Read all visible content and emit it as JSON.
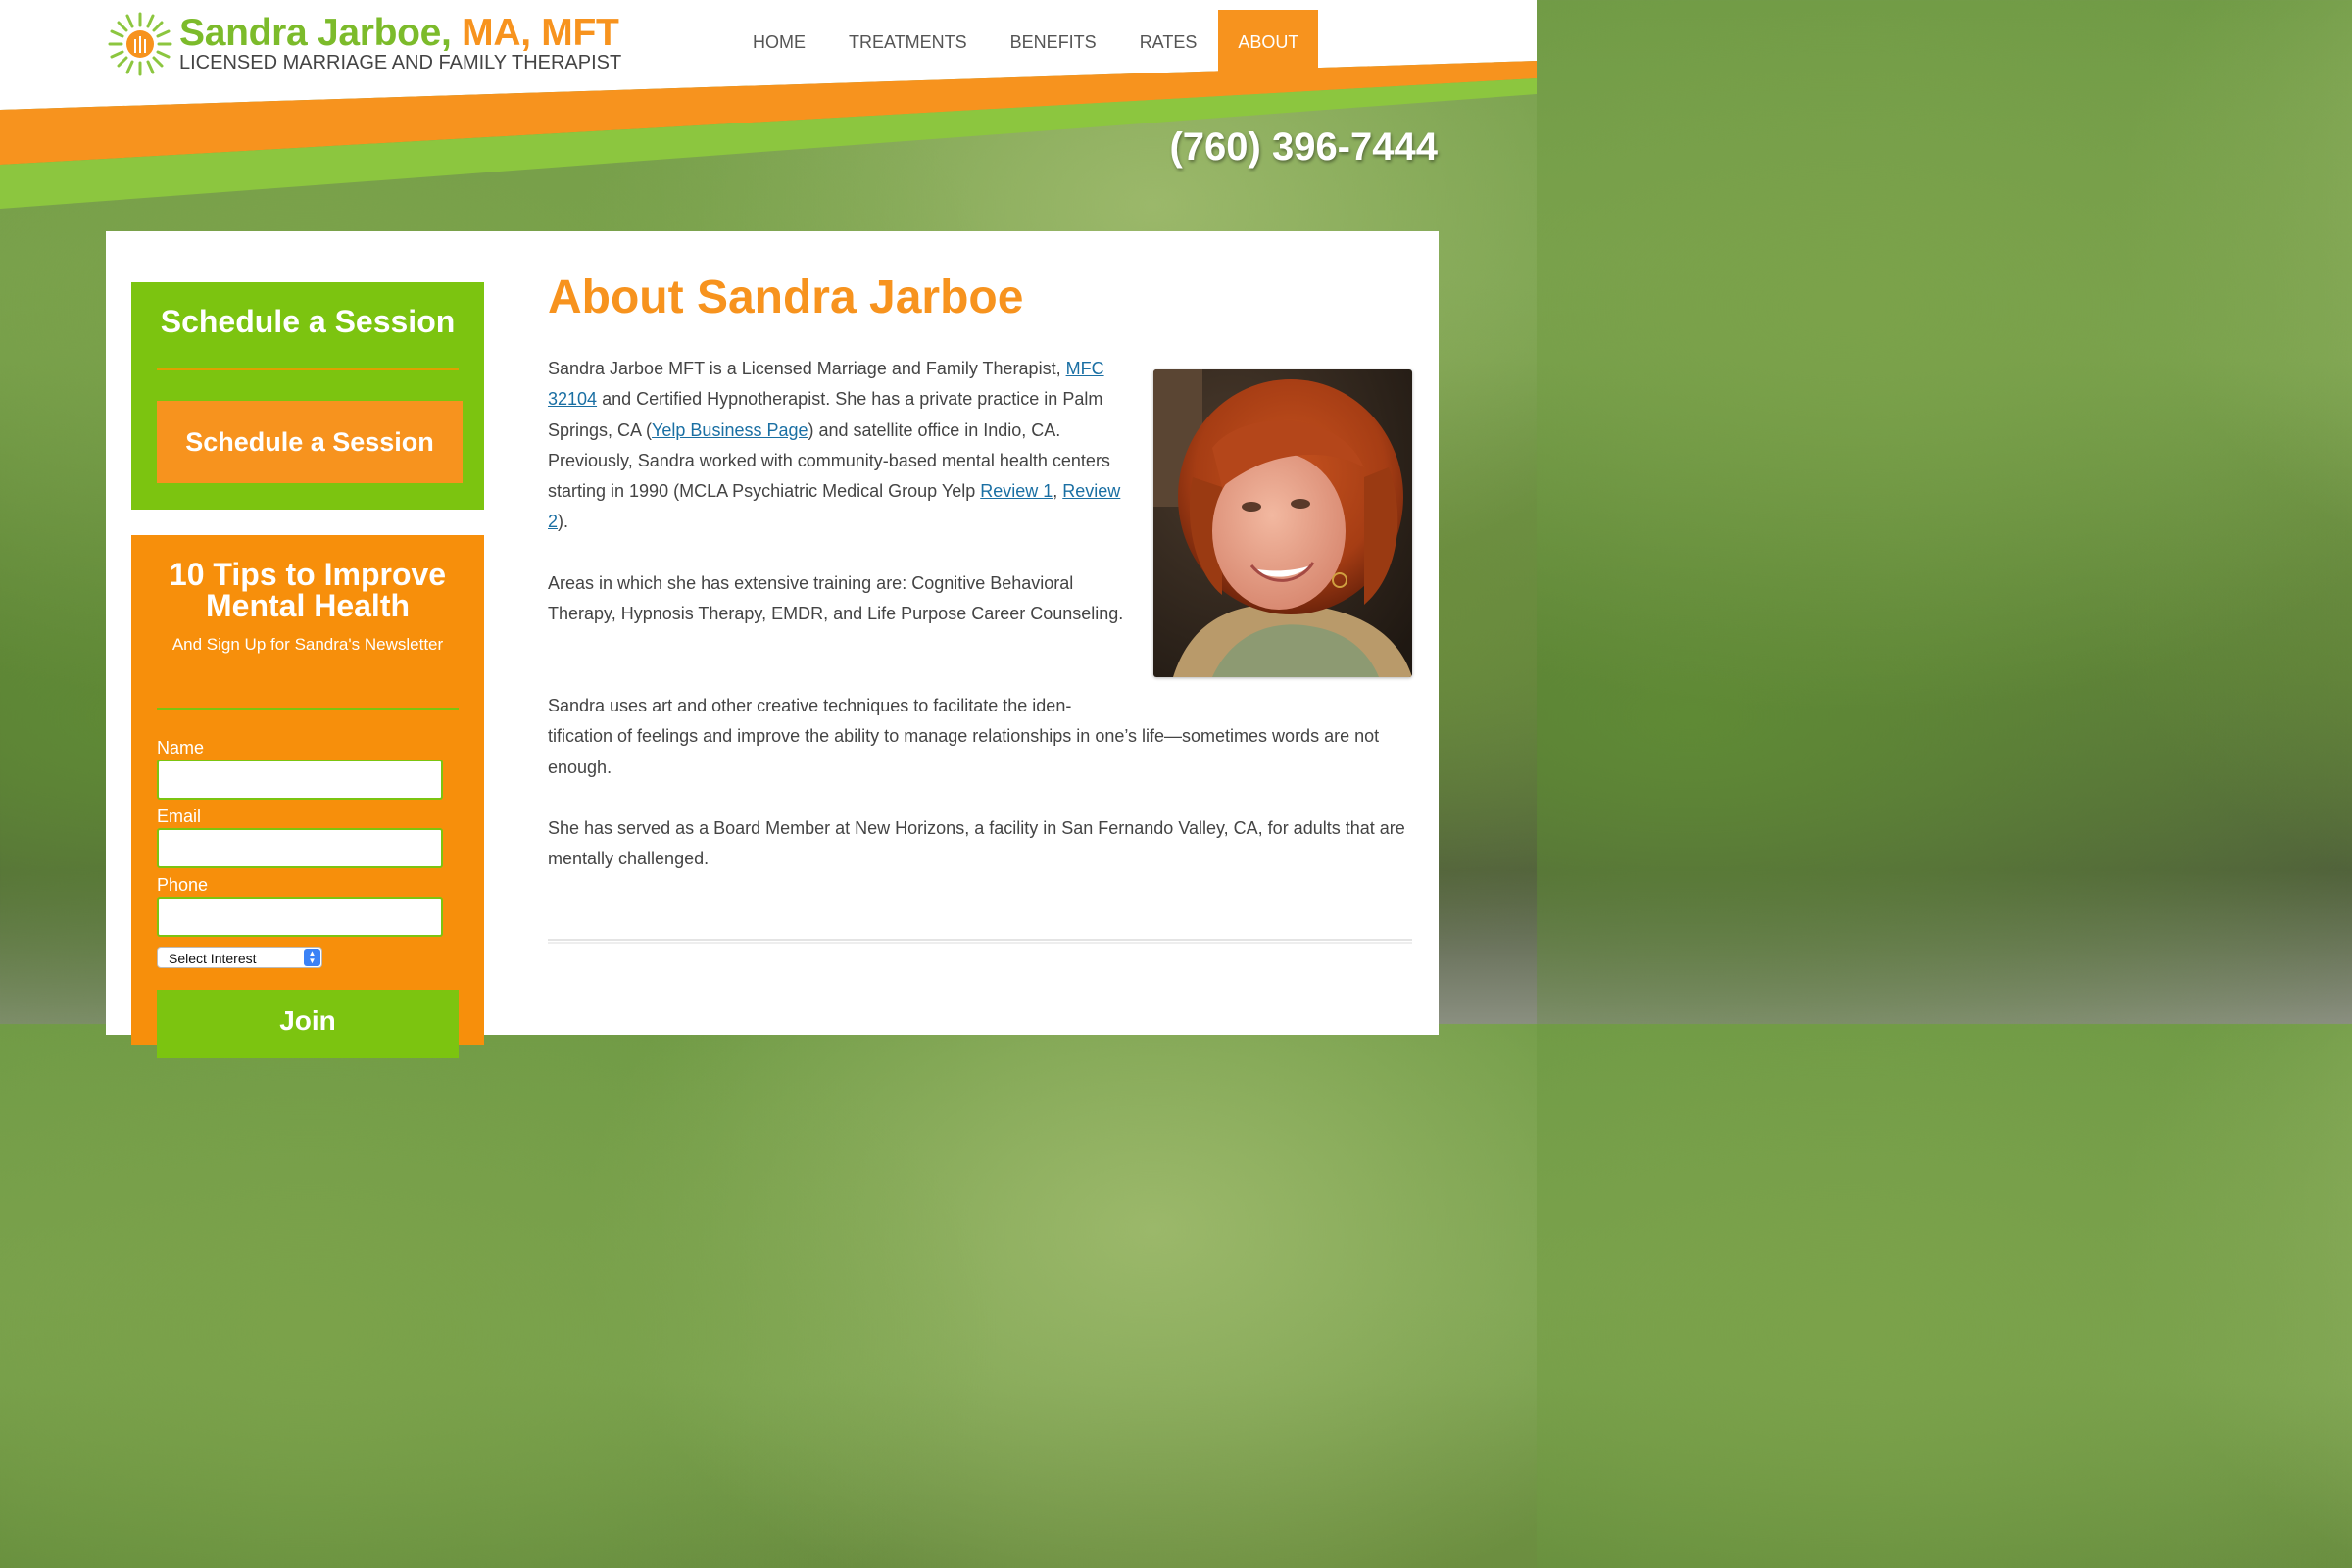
{
  "brand": {
    "name_part1": "Sandra Jarboe,",
    "name_part2": "MA, MFT",
    "subtitle": "LICENSED MARRIAGE AND FAMILY THERAPIST",
    "accent_orange": "#f7931e",
    "accent_green": "#7cc410"
  },
  "nav": {
    "items": [
      {
        "label": "HOME"
      },
      {
        "label": "TREATMENTS"
      },
      {
        "label": "BENEFITS"
      },
      {
        "label": "RATES"
      },
      {
        "label": "ABOUT",
        "active": true
      }
    ]
  },
  "phone": "(760) 396-7444",
  "sidebar": {
    "schedule": {
      "title": "Schedule a Session",
      "button": "Schedule a Session"
    },
    "newsletter": {
      "title_line1": "10 Tips to Improve",
      "title_line2": "Mental Health",
      "subtitle": "And Sign Up for Sandra's Newsletter",
      "name_label": "Name",
      "name_value": "",
      "email_label": "Email",
      "email_value": "",
      "phone_label": "Phone",
      "phone_value": "",
      "select_value": "Select Interest",
      "join_button": "Join"
    }
  },
  "main": {
    "title": "About Sandra Jarboe",
    "photo_icon": "portrait-photo",
    "p1": {
      "a": "Sandra Jarboe MFT is a Licensed Marriage and Family Therapist, ",
      "link_mfc": "MFC 32104",
      "b": " and Certified Hypnotherapist.  She has a private practice in Palm Springs, CA (",
      "link_yelp": "Yelp Business Page",
      "c": ") and satellite office in Indio, CA.  Previously, Sandra worked with community-based mental health centers starting in 1990 (MCLA Psychiatric Medical Group Yelp ",
      "link_r1": "Review 1",
      "d": ", ",
      "link_r2": "Review 2",
      "e": ")."
    },
    "p2": "Areas in which she has extensive training are: Cognitive Behavioral Therapy, Hypnosis Therapy, EMDR, and Life Purpose Career Counseling.",
    "p3_line1": "Sandra uses art and other creative techniques to facilitate the   iden-",
    "p3_rest": "tification of feelings and improve the ability to manage relationships in one’s life—sometimes words are not enough.",
    "p4": "She has served as a Board Member at New Horizons, a facility in San Fernando Valley, CA, for adults that are mentally challenged."
  }
}
